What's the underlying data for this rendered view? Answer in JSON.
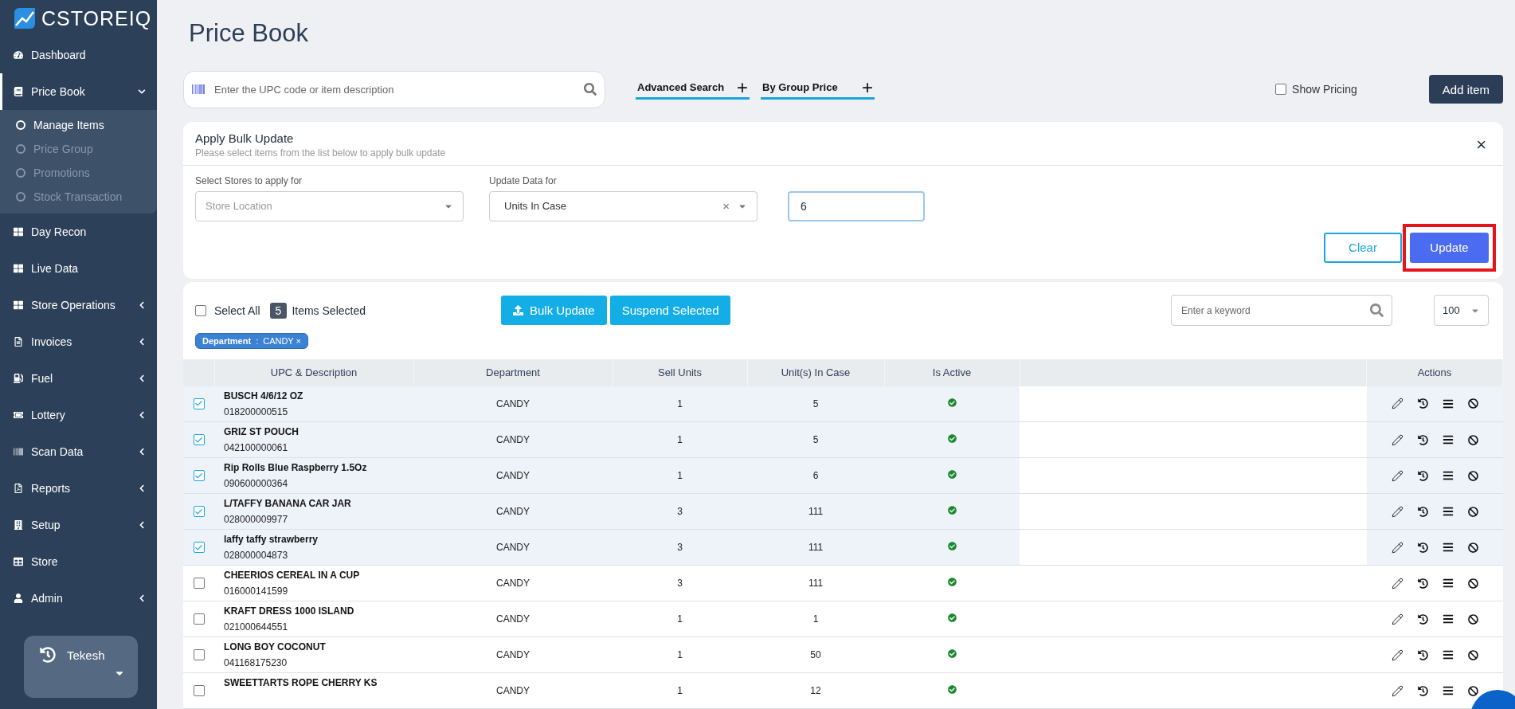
{
  "brand": "CSTOREIQ",
  "sidebar": {
    "items": [
      {
        "label": "Dashboard",
        "kind": "link"
      },
      {
        "label": "Price Book",
        "kind": "menu",
        "expanded": true,
        "selected": true,
        "children": [
          {
            "label": "Manage Items",
            "selected": true
          },
          {
            "label": "Price Group",
            "selected": false
          },
          {
            "label": "Promotions",
            "selected": false
          },
          {
            "label": "Stock Transaction",
            "selected": false
          }
        ]
      },
      {
        "label": "Day Recon",
        "kind": "link"
      },
      {
        "label": "Live Data",
        "kind": "link"
      },
      {
        "label": "Store Operations",
        "kind": "menu",
        "expanded": false,
        "selected": false
      },
      {
        "label": "Invoices",
        "kind": "menu",
        "expanded": false,
        "selected": false
      },
      {
        "label": "Fuel",
        "kind": "menu",
        "expanded": false,
        "selected": false
      },
      {
        "label": "Lottery",
        "kind": "menu",
        "expanded": false,
        "selected": false
      },
      {
        "label": "Scan Data",
        "kind": "menu",
        "expanded": false,
        "selected": false
      },
      {
        "label": "Reports",
        "kind": "menu",
        "expanded": false,
        "selected": false
      },
      {
        "label": "Setup",
        "kind": "menu",
        "expanded": false,
        "selected": false
      },
      {
        "label": "Store",
        "kind": "link"
      },
      {
        "label": "Admin",
        "kind": "menu",
        "expanded": false,
        "selected": false
      }
    ],
    "user": {
      "name": "Tekesh"
    }
  },
  "page_title": "Price Book",
  "search": {
    "placeholder": "Enter the UPC code or item description"
  },
  "filters": [
    {
      "label": "Advanced Search",
      "icon": "+"
    },
    {
      "label": "By Group Price",
      "icon": "+"
    }
  ],
  "show_pricing": {
    "label": "Show Pricing",
    "checked": false
  },
  "add_item": "Add item",
  "bulk_update": {
    "title": "Apply Bulk Update",
    "subtitle": "Please select items from the list below to apply bulk update",
    "close": "×",
    "store_field": {
      "label": "Select Stores to apply for",
      "placeholder": "Store Location"
    },
    "data_field": {
      "label": "Update Data for",
      "value": "Units In Case",
      "clear": "×"
    },
    "value_field": {
      "value": "6"
    },
    "buttons": [
      {
        "label": "Clear",
        "kind": "outline",
        "highlighted": false
      },
      {
        "label": "Update",
        "kind": "primary",
        "highlighted": true
      }
    ]
  },
  "toolbar": {
    "select_all": {
      "label": "Select All",
      "checked": false
    },
    "selected_count": "5",
    "selected_label": "Items Selected",
    "buttons": [
      {
        "label": "Bulk Update",
        "kind": "upload"
      },
      {
        "label": "Suspend Selected",
        "kind": "plain"
      }
    ],
    "keyword": {
      "placeholder": "Enter a keyword"
    },
    "page_size": "100",
    "filter_tag": {
      "label": "Department",
      "separator": ":",
      "value": "CANDY",
      "remove": "×"
    }
  },
  "table": {
    "columns": [
      "UPC & Description",
      "Department",
      "Sell Units",
      "Unit(s) In Case",
      "Is Active",
      "",
      "Actions"
    ],
    "rows": [
      {
        "selected": true,
        "name": "BUSCH 4/6/12 OZ",
        "upc": "018200000515",
        "department": "CANDY",
        "sell_units": "1",
        "units_in_case": "5",
        "active": true
      },
      {
        "selected": true,
        "name": "GRIZ ST POUCH",
        "upc": "042100000061",
        "department": "CANDY",
        "sell_units": "1",
        "units_in_case": "5",
        "active": true
      },
      {
        "selected": true,
        "name": "Rip Rolls Blue Raspberry 1.5Oz",
        "upc": "090600000364",
        "department": "CANDY",
        "sell_units": "1",
        "units_in_case": "6",
        "active": true
      },
      {
        "selected": true,
        "name": "L/TAFFY BANANA CAR JAR",
        "upc": "028000009977",
        "department": "CANDY",
        "sell_units": "3",
        "units_in_case": "111",
        "active": true
      },
      {
        "selected": true,
        "name": "laffy taffy strawberry",
        "upc": "028000004873",
        "department": "CANDY",
        "sell_units": "3",
        "units_in_case": "111",
        "active": true
      },
      {
        "selected": false,
        "name": "CHEERIOS CEREAL IN A CUP",
        "upc": "016000141599",
        "department": "CANDY",
        "sell_units": "3",
        "units_in_case": "111",
        "active": true
      },
      {
        "selected": false,
        "name": "KRAFT DRESS 1000 ISLAND",
        "upc": "021000644551",
        "department": "CANDY",
        "sell_units": "1",
        "units_in_case": "1",
        "active": true
      },
      {
        "selected": false,
        "name": "LONG BOY COCONUT",
        "upc": "041168175230",
        "department": "CANDY",
        "sell_units": "1",
        "units_in_case": "50",
        "active": true
      },
      {
        "selected": false,
        "name": "SWEETTARTS ROPE CHERRY KS",
        "department": "CANDY",
        "sell_units": "1",
        "units_in_case": "12",
        "active": true
      }
    ]
  }
}
